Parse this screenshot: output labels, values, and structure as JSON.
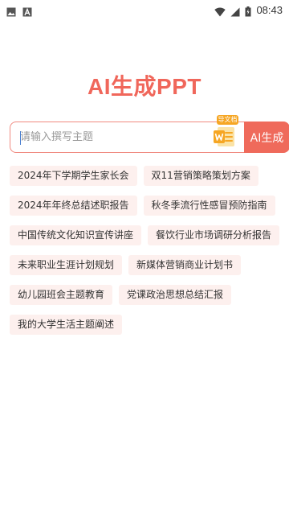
{
  "status_bar": {
    "time": "08:43",
    "left_icons": [
      "image-icon",
      "text-a-icon"
    ],
    "right_icons": [
      "wifi-icon",
      "signal-icon",
      "battery-icon"
    ]
  },
  "app": {
    "title": "AI生成PPT",
    "accent_color": "#ef6a5b"
  },
  "search": {
    "placeholder": "请输入撰写主题",
    "value": "",
    "import_label": "导文档",
    "import_icon": "word-doc-icon",
    "generate_label": "AI生成"
  },
  "suggestions": [
    [
      "2024年下学期学生家长会",
      "双11营销策略策划方案"
    ],
    [
      "2024年年终总结述职报告",
      "秋冬季流行性感冒预防指南"
    ],
    [
      "中国传统文化知识宣传讲座",
      "餐饮行业市场调研分析报告"
    ],
    [
      "未来职业生涯计划规划",
      "新媒体营销商业计划书"
    ],
    [
      "幼儿园班会主题教育",
      "党课政治思想总结汇报"
    ],
    [
      "我的大学生活主题阐述"
    ]
  ]
}
